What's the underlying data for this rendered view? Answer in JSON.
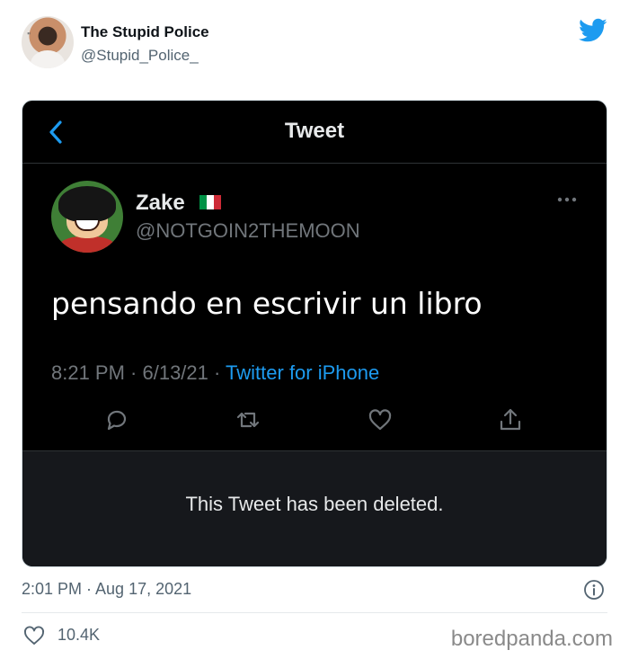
{
  "outer_tweet": {
    "display_name": "The Stupid Police",
    "handle": "@Stupid_Police_",
    "avatar_icon": "profile-photo",
    "timestamp": "2:01 PM · Aug 17, 2021",
    "like_count": "10.4K"
  },
  "screenshot": {
    "nav_title": "Tweet",
    "author_name": "Zake",
    "author_handle": "@NOTGOIN2THEMOON",
    "flag_colors": [
      "#009246",
      "#ffffff",
      "#ce2b37"
    ],
    "text": "pensando en escrivir un libro",
    "time": "8:21 PM · 6/13/21 · ",
    "source": "Twitter for iPhone",
    "deleted_notice": "This Tweet has been deleted."
  },
  "colors": {
    "twitter_blue": "#1d9bf0",
    "dark_bg": "#000000",
    "muted": "#71767b"
  },
  "watermark": "boredpanda.com"
}
